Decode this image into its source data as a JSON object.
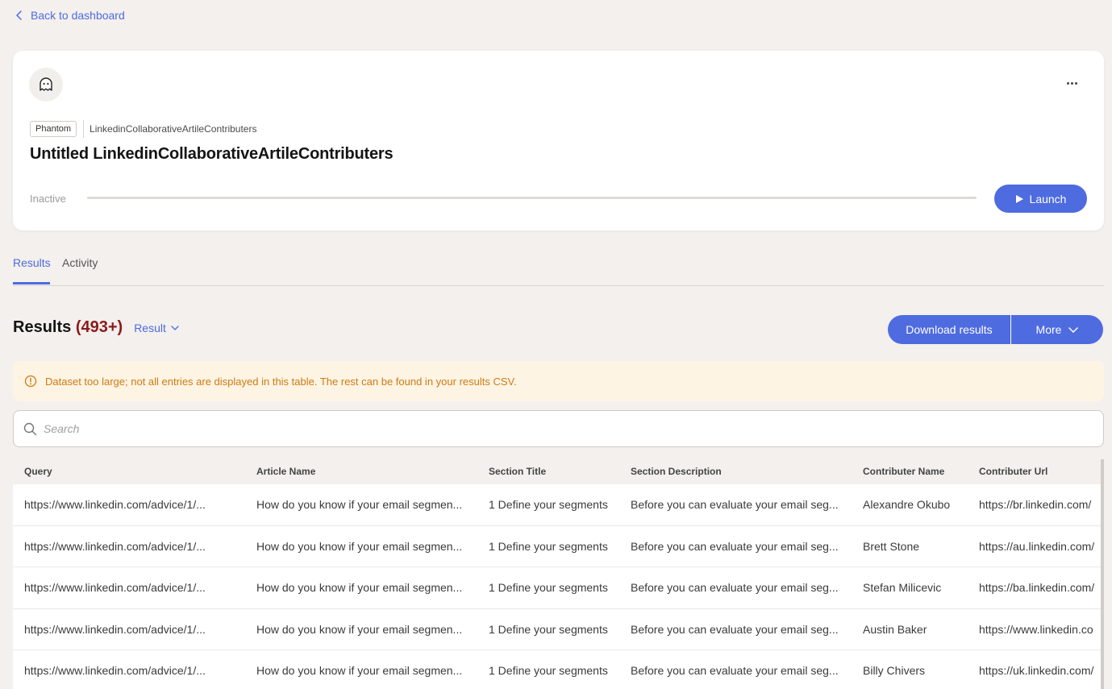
{
  "nav": {
    "back_label": "Back to dashboard"
  },
  "agent": {
    "tag": "Phantom",
    "type": "LinkedinCollaborativeArtileContributers",
    "title": "Untitled LinkedinCollaborativeArtileContributers",
    "status": "Inactive",
    "progress": 0,
    "launch_label": "Launch"
  },
  "tabs": [
    {
      "label": "Results",
      "active": true
    },
    {
      "label": "Activity",
      "active": false
    }
  ],
  "results": {
    "title": "Results",
    "count": "(493+)",
    "selector_label": "Result",
    "download_label": "Download results",
    "more_label": "More"
  },
  "warning": {
    "text": "Dataset too large; not all entries are displayed in this table. The rest can be found in your results CSV."
  },
  "search": {
    "placeholder": "Search"
  },
  "table": {
    "columns": [
      "Query",
      "Article Name",
      "Section Title",
      "Section Description",
      "Contributer Name",
      "Contributer Url"
    ],
    "rows": [
      [
        "https://www.linkedin.com/advice/1/...",
        "How do you know if your email segmen...",
        "1 Define your segments",
        "Before you can evaluate your email seg...",
        "Alexandre Okubo",
        "https://br.linkedin.com/"
      ],
      [
        "https://www.linkedin.com/advice/1/...",
        "How do you know if your email segmen...",
        "1 Define your segments",
        "Before you can evaluate your email seg...",
        "Brett Stone",
        "https://au.linkedin.com/"
      ],
      [
        "https://www.linkedin.com/advice/1/...",
        "How do you know if your email segmen...",
        "1 Define your segments",
        "Before you can evaluate your email seg...",
        "Stefan Milicevic",
        "https://ba.linkedin.com/"
      ],
      [
        "https://www.linkedin.com/advice/1/...",
        "How do you know if your email segmen...",
        "1 Define your segments",
        "Before you can evaluate your email seg...",
        "Austin Baker",
        "https://www.linkedin.co"
      ],
      [
        "https://www.linkedin.com/advice/1/...",
        "How do you know if your email segmen...",
        "1 Define your segments",
        "Before you can evaluate your email seg...",
        "Billy Chivers",
        "https://uk.linkedin.com/"
      ]
    ]
  },
  "icons": {
    "back": "chevron-left-icon",
    "avatar": "ghost-icon",
    "menu": "more-horizontal-icon",
    "launch": "play-icon",
    "selector": "chevron-down-icon",
    "warning": "alert-circle-icon",
    "search": "search-icon"
  },
  "colors": {
    "accent": "#4e6be0",
    "count": "#8b1a1a",
    "warning_text": "#d07a10",
    "warning_bg": "#fdf4e4",
    "page_bg": "#f3f0ed"
  }
}
